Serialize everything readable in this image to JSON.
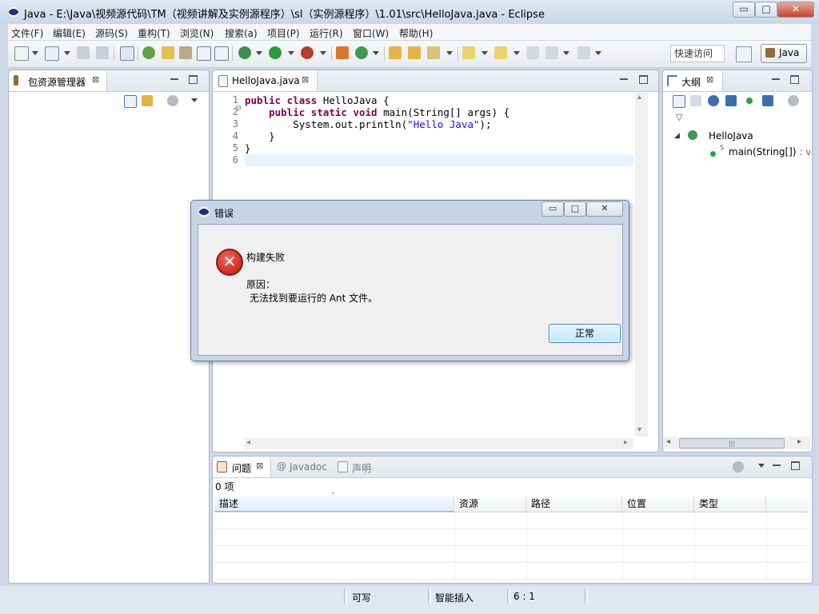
{
  "window": {
    "title": "Java  -  E:\\Java\\视频源代码\\TM（视频讲解及实例源程序）\\sl（实例源程序）\\1.01\\src\\HelloJava.java  -  Eclipse",
    "min_glyph": "▭",
    "max_glyph": "□",
    "close_glyph": "✕"
  },
  "menu": {
    "items": [
      {
        "label": "文件(F)"
      },
      {
        "label": "编辑(E)"
      },
      {
        "label": "源码(S)"
      },
      {
        "label": "重构(T)"
      },
      {
        "label": "浏览(N)"
      },
      {
        "label": "搜索(a)"
      },
      {
        "label": "项目(P)"
      },
      {
        "label": "运行(R)"
      },
      {
        "label": "窗口(W)"
      },
      {
        "label": "帮助(H)"
      }
    ]
  },
  "toolbar": {
    "quick_access": "快速访问",
    "perspective_label": "Java"
  },
  "package_explorer": {
    "tab_label": "包资源管理器",
    "close_glyph": "⊠"
  },
  "editor": {
    "tab_label": "HelloJava.java",
    "close_glyph": "⊠",
    "line_numbers": "1\n2\n3\n4\n5\n6",
    "lines": [
      {
        "kw1": "public class",
        "rest": " HelloJava {"
      },
      {
        "indent": "    ",
        "kw1": "public static void",
        "rest": " main(String[] args) {"
      },
      {
        "indent": "        ",
        "pre": "System.out.println(",
        "str": "\"Hello Java\"",
        "post": ");"
      },
      {
        "indent": "    ",
        "pre": "}"
      },
      {
        "pre": "}"
      }
    ],
    "fold_glyph": "⊖"
  },
  "outline": {
    "tab_label": "大纲",
    "close_glyph": "⊠",
    "class_name": "HelloJava",
    "method_label": "main(String[])",
    "method_suffix": " : vc",
    "static_marker": "S",
    "expand_glyph": "◢",
    "filter_glyph": "▽"
  },
  "dialog": {
    "title": "错误",
    "heading": "构建失败",
    "reason_label": "原因：",
    "reason_text": "无法找到要运行的 Ant 文件。",
    "ok_label": "正常",
    "error_glyph": "✕",
    "min_glyph": "▭",
    "max_glyph": "□",
    "close_glyph": "✕"
  },
  "bottom_panel": {
    "tabs": [
      {
        "label": "问题"
      },
      {
        "label": "Javadoc"
      },
      {
        "label": "声明"
      }
    ],
    "close_glyph": "⊠",
    "at_glyph": "@",
    "item_count": "0 项",
    "columns": [
      {
        "label": "描述"
      },
      {
        "label": "资源"
      },
      {
        "label": "路径"
      },
      {
        "label": "位置"
      },
      {
        "label": "类型"
      }
    ],
    "sort_glyph": "˄"
  },
  "statusbar": {
    "writable": "可写",
    "insert_mode": "智能插入",
    "position": "6 : 1"
  },
  "scroll": {
    "left_arrow": "◂",
    "right_arrow": "▸",
    "up_arrow": "▴",
    "down_arrow": "▾",
    "thumb_grip": "|||"
  }
}
